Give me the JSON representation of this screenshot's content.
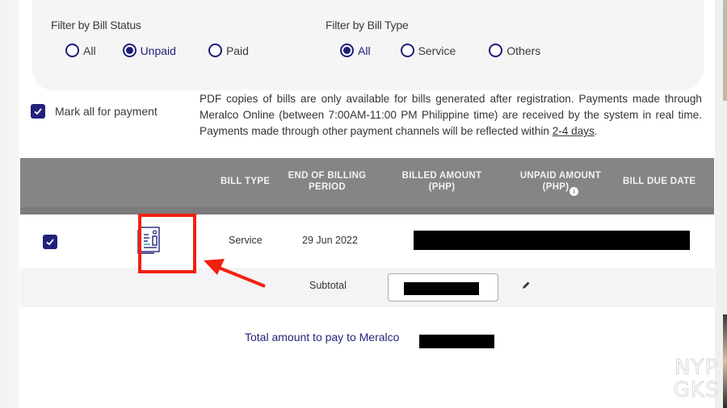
{
  "filters": {
    "bill_status": {
      "title": "Filter by Bill Status",
      "options": [
        {
          "label": "All",
          "selected": false
        },
        {
          "label": "Unpaid",
          "selected": true
        },
        {
          "label": "Paid",
          "selected": false
        }
      ]
    },
    "bill_type": {
      "title": "Filter by Bill Type",
      "options": [
        {
          "label": "All",
          "selected": true
        },
        {
          "label": "Service",
          "selected": false
        },
        {
          "label": "Others",
          "selected": false
        }
      ]
    }
  },
  "mark_all": {
    "label": "Mark all for payment",
    "checked": true
  },
  "notice": {
    "line1": "PDF copies of bills are only available for bills generated after registration. Payments made through",
    "line2": "Meralco Online (between 7:00AM-11:00 PM Philippine time) are received by the system in real time.",
    "line3_prefix": "Payments made through other payment channels will be reflected within ",
    "line3_link": "2-4 days",
    "line3_suffix": "."
  },
  "table": {
    "headers": {
      "bill_type": "BILL TYPE",
      "end_of_billing_period_1": "END OF BILLING",
      "end_of_billing_period_2": "PERIOD",
      "billed_amount_1": "BILLED AMOUNT",
      "billed_amount_2": "(PHP)",
      "unpaid_amount_1": "UNPAID AMOUNT",
      "unpaid_amount_2": "(PHP)",
      "info_icon": "i",
      "bill_due_date": "BILL DUE DATE"
    },
    "rows": [
      {
        "checked": true,
        "icon": "bill-document-icon",
        "bill_type": "Service",
        "end_of_billing_period": "29 Jun 2022",
        "billed_amount": "[redacted]",
        "unpaid_amount": "[redacted]",
        "bill_due_date": "[redacted]"
      }
    ],
    "subtotal": {
      "label": "Subtotal",
      "value": "[redacted]",
      "edit_icon": "pencil-icon"
    }
  },
  "total": {
    "label": "Total amount to pay to Meralco",
    "value": "[redacted]"
  },
  "annotation": {
    "color": "#f2200f"
  },
  "watermark": {
    "line1": "NYP",
    "line2": "GKS"
  },
  "colors": {
    "primary": "#1d1d7a",
    "header_bg": "#858585",
    "highlight": "#f2200f"
  }
}
